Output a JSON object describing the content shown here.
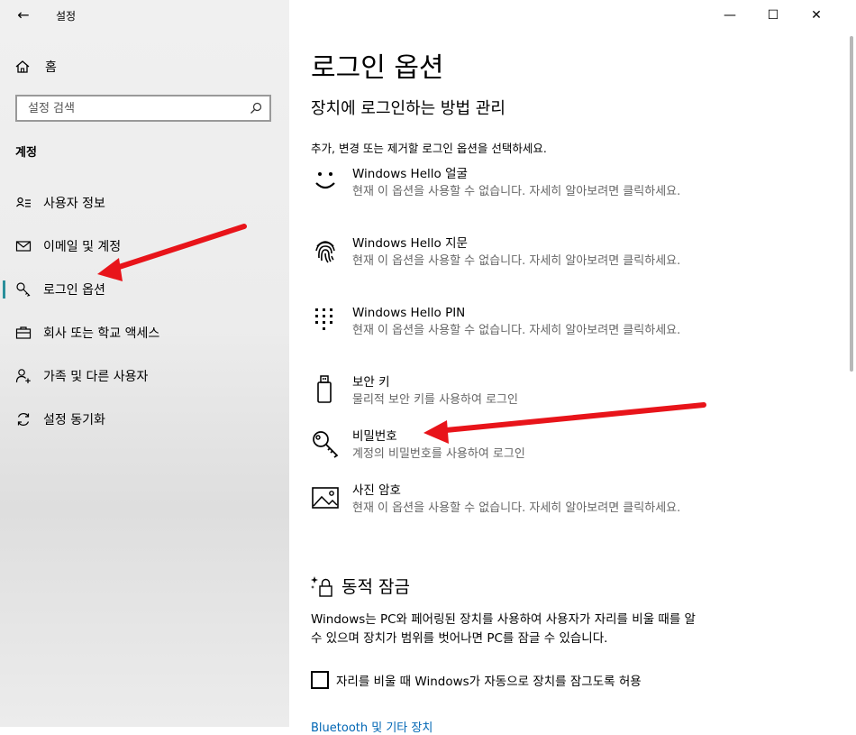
{
  "window": {
    "app_title": "설정",
    "back_label": "←",
    "controls": {
      "minimize": "—",
      "maximize": "☐",
      "close": "✕"
    }
  },
  "sidebar": {
    "home_label": "홈",
    "search_placeholder": "설정 검색",
    "section_header": "계정",
    "items": [
      {
        "label": "사용자 정보"
      },
      {
        "label": "이메일 및 계정"
      },
      {
        "label": "로그인 옵션"
      },
      {
        "label": "회사 또는 학교 액세스"
      },
      {
        "label": "가족 및 다른 사용자"
      },
      {
        "label": "설정 동기화"
      }
    ],
    "active_item": "로그인 옵션"
  },
  "main": {
    "title": "로그인 옵션",
    "subtitle": "장치에 로그인하는 방법 관리",
    "instruction": "추가, 변경 또는 제거할 로그인 옵션을 선택하세요.",
    "options": [
      {
        "title": "Windows Hello 얼굴",
        "description": "현재 이 옵션을 사용할 수 없습니다. 자세히 알아보려면 클릭하세요.",
        "icon": "smile-face-icon"
      },
      {
        "title": "Windows Hello 지문",
        "description": "현재 이 옵션을 사용할 수 없습니다. 자세히 알아보려면 클릭하세요.",
        "icon": "fingerprint-icon"
      },
      {
        "title": "Windows Hello PIN",
        "description": "현재 이 옵션을 사용할 수 없습니다. 자세히 알아보려면 클릭하세요.",
        "icon": "pin-keypad-icon"
      },
      {
        "title": "보안 키",
        "description": "물리적 보안 키를 사용하여 로그인",
        "icon": "usb-security-key-icon"
      },
      {
        "title": "비밀번호",
        "description": "계정의 비밀번호를 사용하여 로그인",
        "icon": "key-icon"
      },
      {
        "title": "사진 암호",
        "description": "현재 이 옵션을 사용할 수 없습니다. 자세히 알아보려면 클릭하세요.",
        "icon": "picture-icon"
      }
    ],
    "dynamic_lock": {
      "title": "동적 잠금",
      "description": "Windows는 PC와 페어링된 장치를 사용하여 사용자가 자리를 비울 때를 알 수 있으며 장치가 범위를 벗어나면 PC를 잠글 수 있습니다.",
      "checkbox_label": "자리를 비울 때 Windows가 자동으로 장치를 잠그도록 허용",
      "checked": false
    },
    "link_text": "Bluetooth 및 기타 장치"
  },
  "colors": {
    "accent": "#2a8f9b",
    "link": "#0066b4",
    "annotation_arrow": "#e8141a"
  }
}
